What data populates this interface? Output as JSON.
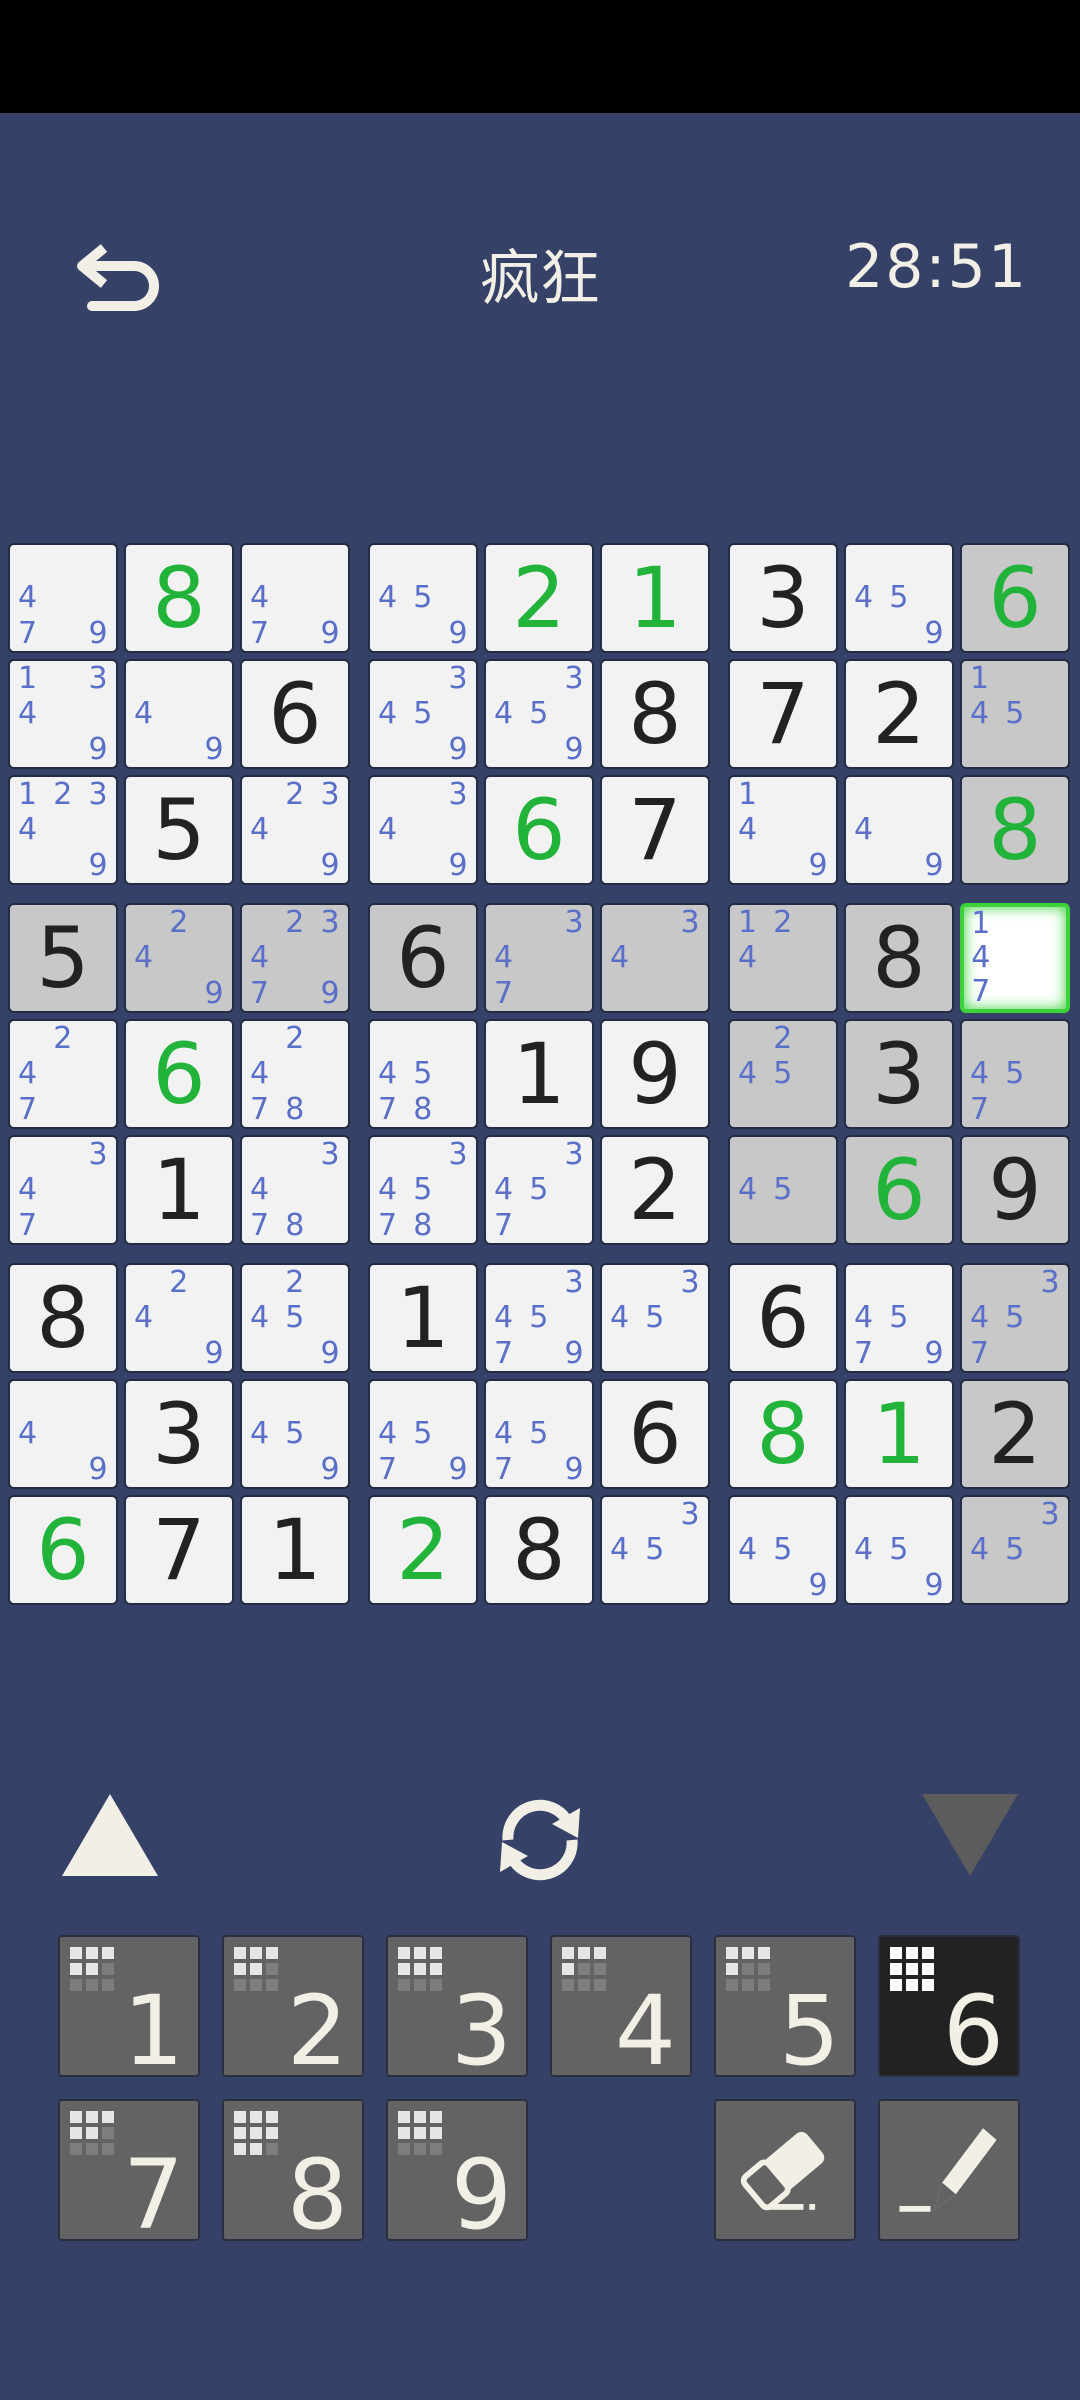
{
  "header": {
    "title": "疯狂",
    "timer": "28:51"
  },
  "colors": {
    "background": "#354166",
    "given": "#222222",
    "user": "#22b33a",
    "candidate": "#5a6fc8",
    "selected_border": "#3bd23b"
  },
  "board": {
    "selected": [
      3,
      8
    ],
    "shaded": [
      [
        0,
        8
      ],
      [
        1,
        8
      ],
      [
        2,
        8
      ],
      [
        3,
        0
      ],
      [
        3,
        1
      ],
      [
        3,
        2
      ],
      [
        3,
        3
      ],
      [
        3,
        4
      ],
      [
        3,
        5
      ],
      [
        3,
        6
      ],
      [
        3,
        7
      ],
      [
        4,
        6
      ],
      [
        4,
        7
      ],
      [
        4,
        8
      ],
      [
        5,
        6
      ],
      [
        5,
        7
      ],
      [
        5,
        8
      ],
      [
        6,
        8
      ],
      [
        7,
        8
      ],
      [
        8,
        8
      ]
    ],
    "cells": [
      [
        {
          "c": [
            4,
            7,
            9
          ]
        },
        {
          "v": 8,
          "t": "user"
        },
        {
          "c": [
            4,
            7,
            9
          ]
        },
        {
          "c": [
            4,
            5,
            9
          ]
        },
        {
          "v": 2,
          "t": "user"
        },
        {
          "v": 1,
          "t": "user"
        },
        {
          "v": 3,
          "t": "given"
        },
        {
          "c": [
            4,
            5,
            9
          ]
        },
        {
          "v": 6,
          "t": "user"
        }
      ],
      [
        {
          "c": [
            1,
            3,
            4,
            9
          ]
        },
        {
          "c": [
            4,
            9
          ]
        },
        {
          "v": 6,
          "t": "given"
        },
        {
          "c": [
            3,
            4,
            5,
            9
          ]
        },
        {
          "c": [
            3,
            4,
            5,
            9
          ]
        },
        {
          "v": 8,
          "t": "given"
        },
        {
          "v": 7,
          "t": "given"
        },
        {
          "v": 2,
          "t": "given"
        },
        {
          "c": [
            1,
            4,
            5
          ]
        }
      ],
      [
        {
          "c": [
            1,
            2,
            3,
            4,
            9
          ]
        },
        {
          "v": 5,
          "t": "given"
        },
        {
          "c": [
            2,
            3,
            4,
            9
          ]
        },
        {
          "c": [
            3,
            4,
            9
          ]
        },
        {
          "v": 6,
          "t": "user"
        },
        {
          "v": 7,
          "t": "given"
        },
        {
          "c": [
            1,
            4,
            9
          ]
        },
        {
          "c": [
            4,
            9
          ]
        },
        {
          "v": 8,
          "t": "user"
        }
      ],
      [
        {
          "v": 5,
          "t": "given"
        },
        {
          "c": [
            2,
            4,
            9
          ]
        },
        {
          "c": [
            2,
            3,
            4,
            7,
            9
          ]
        },
        {
          "v": 6,
          "t": "given"
        },
        {
          "c": [
            3,
            4,
            7
          ]
        },
        {
          "c": [
            3,
            4
          ]
        },
        {
          "c": [
            1,
            2,
            4
          ]
        },
        {
          "v": 8,
          "t": "given"
        },
        {
          "c": [
            1,
            4,
            7
          ]
        }
      ],
      [
        {
          "c": [
            2,
            4,
            7
          ]
        },
        {
          "v": 6,
          "t": "user"
        },
        {
          "c": [
            2,
            4,
            7,
            8
          ]
        },
        {
          "c": [
            4,
            5,
            7,
            8
          ]
        },
        {
          "v": 1,
          "t": "given"
        },
        {
          "v": 9,
          "t": "given"
        },
        {
          "c": [
            2,
            4,
            5
          ]
        },
        {
          "v": 3,
          "t": "given"
        },
        {
          "c": [
            4,
            5,
            7
          ]
        }
      ],
      [
        {
          "c": [
            3,
            4,
            7
          ]
        },
        {
          "v": 1,
          "t": "given"
        },
        {
          "c": [
            3,
            4,
            7,
            8
          ]
        },
        {
          "c": [
            3,
            4,
            5,
            7,
            8
          ]
        },
        {
          "c": [
            3,
            4,
            5,
            7
          ]
        },
        {
          "v": 2,
          "t": "given"
        },
        {
          "c": [
            4,
            5
          ]
        },
        {
          "v": 6,
          "t": "user"
        },
        {
          "v": 9,
          "t": "given"
        }
      ],
      [
        {
          "v": 8,
          "t": "given"
        },
        {
          "c": [
            2,
            4,
            9
          ]
        },
        {
          "c": [
            2,
            4,
            5,
            9
          ]
        },
        {
          "v": 1,
          "t": "given"
        },
        {
          "c": [
            3,
            4,
            5,
            7,
            9
          ]
        },
        {
          "c": [
            3,
            4,
            5
          ]
        },
        {
          "v": 6,
          "t": "given"
        },
        {
          "c": [
            4,
            5,
            7,
            9
          ]
        },
        {
          "c": [
            3,
            4,
            5,
            7
          ]
        }
      ],
      [
        {
          "c": [
            4,
            9
          ]
        },
        {
          "v": 3,
          "t": "given"
        },
        {
          "c": [
            4,
            5,
            9
          ]
        },
        {
          "c": [
            4,
            5,
            7,
            9
          ]
        },
        {
          "c": [
            4,
            5,
            7,
            9
          ]
        },
        {
          "v": 6,
          "t": "given"
        },
        {
          "v": 8,
          "t": "user"
        },
        {
          "v": 1,
          "t": "user"
        },
        {
          "v": 2,
          "t": "given"
        }
      ],
      [
        {
          "v": 6,
          "t": "user"
        },
        {
          "v": 7,
          "t": "given"
        },
        {
          "v": 1,
          "t": "given"
        },
        {
          "v": 2,
          "t": "user"
        },
        {
          "v": 8,
          "t": "given"
        },
        {
          "c": [
            3,
            4,
            5
          ]
        },
        {
          "c": [
            4,
            5,
            9
          ]
        },
        {
          "c": [
            4,
            5,
            9
          ]
        },
        {
          "c": [
            3,
            4,
            5
          ]
        }
      ]
    ]
  },
  "keypad": {
    "keys": [
      {
        "label": "1",
        "lit": 5
      },
      {
        "label": "2",
        "lit": 5
      },
      {
        "label": "3",
        "lit": 6
      },
      {
        "label": "4",
        "lit": 4
      },
      {
        "label": "5",
        "lit": 4
      },
      {
        "label": "6",
        "lit": 9,
        "active": true
      },
      {
        "label": "7",
        "lit": 5
      },
      {
        "label": "8",
        "lit": 8
      },
      {
        "label": "9",
        "lit": 6
      }
    ],
    "eraser_icon": "eraser-icon",
    "pencil_icon": "pencil-icon"
  }
}
